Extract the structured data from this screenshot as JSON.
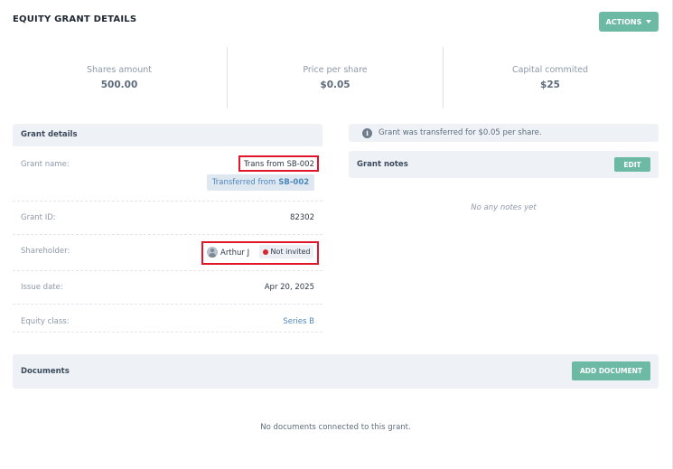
{
  "page": {
    "title": "EQUITY GRANT DETAILS"
  },
  "header": {
    "actions_label": "ACTIONS"
  },
  "stats": [
    {
      "label": "Shares amount",
      "value": "500.00"
    },
    {
      "label": "Price per share",
      "value": "$0.05"
    },
    {
      "label": "Capital commited",
      "value": "$25"
    }
  ],
  "grant_details": {
    "title": "Grant details",
    "grant_name_label": "Grant name:",
    "grant_name_value": "Trans from SB-002",
    "transfer_tag_prefix": "Transferred from",
    "transfer_tag_source": "SB-002",
    "grant_id_label": "Grant ID:",
    "grant_id_value": "82302",
    "shareholder_label": "Shareholder:",
    "shareholder_name": "Arthur J",
    "shareholder_status": "Not invited",
    "issue_date_label": "Issue date:",
    "issue_date_value": "Apr 20, 2025",
    "equity_class_label": "Equity class:",
    "equity_class_value": "Series B"
  },
  "info_banner": {
    "icon": "info-icon",
    "text": "Grant was transferred for $0.05 per share."
  },
  "grant_notes": {
    "title": "Grant notes",
    "edit_label": "EDIT",
    "empty_text": "No any notes yet"
  },
  "documents": {
    "title": "Documents",
    "add_label": "ADD DOCUMENT",
    "empty_text": "No documents connected to this grant."
  },
  "colors": {
    "accent": "#6cb9a4",
    "highlight": "#e0162b",
    "link": "#4e87bd",
    "status_dot": "#d7262e"
  }
}
